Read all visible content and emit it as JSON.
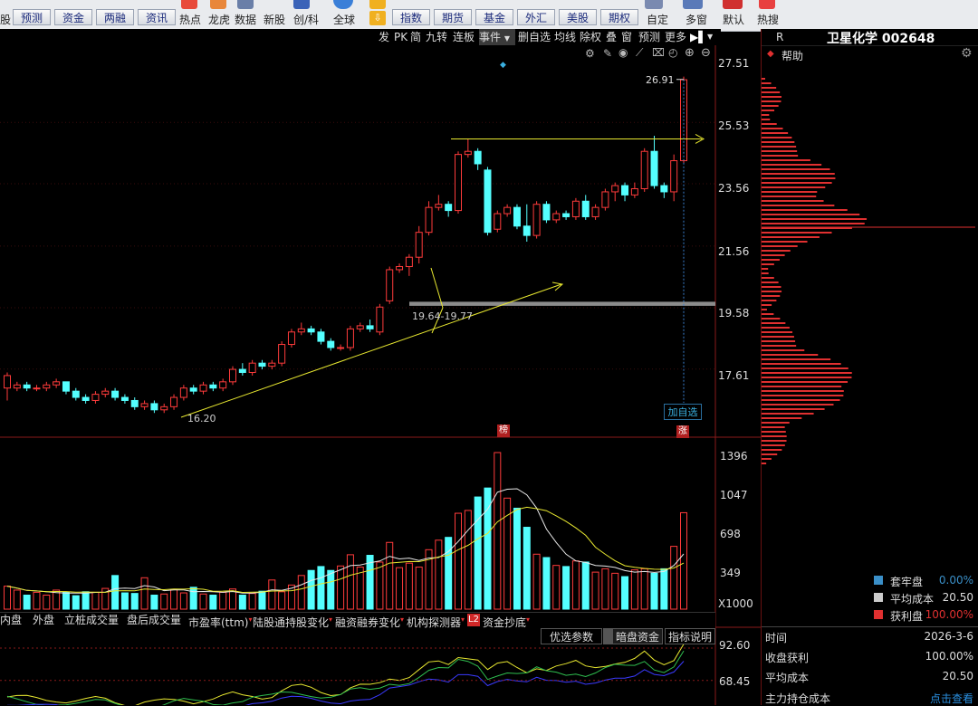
{
  "toolbar": {
    "buttons_row": [
      "预测",
      "资金",
      "两融",
      "资讯"
    ],
    "icon_labels": [
      "热点",
      "龙虎",
      "数据",
      "新股",
      "创/科"
    ],
    "global_label": "全球",
    "market_tabs": [
      "指数",
      "期货",
      "基金",
      "外汇",
      "美股",
      "期权"
    ],
    "right_labels": [
      "自定",
      "多窗",
      "默认",
      "热搜"
    ],
    "left_partial": "股"
  },
  "chartbar": {
    "items": [
      "发",
      "PK",
      "简",
      "九转",
      "连板",
      "事件",
      "删自选",
      "均线",
      "除权",
      "叠",
      "窗",
      "预测",
      "更多"
    ]
  },
  "stock": {
    "r_label": "R",
    "name_code": "卫星化学 002648",
    "help": "帮助"
  },
  "price_axis": [
    "27.51",
    "25.53",
    "23.56",
    "21.56",
    "19.58",
    "17.61"
  ],
  "annotations": {
    "high_label": "26.91",
    "support_label": "19.64-19.77",
    "low_label": "16.20",
    "add_watch": "加自选",
    "bang": "榜",
    "zhang": "涨"
  },
  "volume_axis": [
    "1396",
    "1047",
    "698",
    "349"
  ],
  "volume_unit": "X1000",
  "bottom_tabs": [
    "内盘",
    "外盘",
    "立桩成交量",
    "盘后成交量",
    "市盈率(ttm)",
    "陆股通持股变化",
    "融资融券变化",
    "机构探测器",
    "资金抄底"
  ],
  "l2_badge": "L2",
  "indicator_buttons": [
    "优选参数",
    "暗盘资金",
    "指标说明"
  ],
  "indicator_axis": [
    "92.60",
    "68.45"
  ],
  "legend": [
    {
      "label": "套牢盘",
      "value": "0.00%",
      "color": "#3a8fc8",
      "valcolor": "#3a8fc8"
    },
    {
      "label": "平均成本",
      "value": "20.50",
      "color": "#cccccc",
      "valcolor": "#dddddd"
    },
    {
      "label": "获利盘",
      "value": "100.00%",
      "color": "#e03030",
      "valcolor": "#e03030"
    }
  ],
  "info": [
    {
      "label": "时间",
      "value": "2026-3-6",
      "color": "#dddddd"
    },
    {
      "label": "收盘获利",
      "value": "100.00%",
      "color": "#dddddd"
    },
    {
      "label": "平均成本",
      "value": "20.50",
      "color": "#dddddd"
    },
    {
      "label": "主力持仓成本",
      "value": "点击查看",
      "color": "#2a8fe0"
    }
  ],
  "chart_data": {
    "type": "candlestick",
    "price_range": [
      15.8,
      27.6
    ],
    "candles": [
      [
        17.0,
        17.4,
        16.6,
        17.5
      ],
      [
        17.0,
        17.1,
        16.9,
        17.2
      ],
      [
        17.1,
        17.0,
        16.9,
        17.2
      ],
      [
        17.0,
        17.0,
        16.9,
        17.1
      ],
      [
        17.0,
        17.1,
        16.9,
        17.2
      ],
      [
        17.1,
        17.2,
        17.0,
        17.3
      ],
      [
        17.2,
        16.9,
        16.8,
        17.2
      ],
      [
        16.9,
        16.7,
        16.6,
        17.0
      ],
      [
        16.7,
        16.6,
        16.5,
        16.8
      ],
      [
        16.6,
        16.8,
        16.5,
        16.9
      ],
      [
        16.8,
        16.9,
        16.7,
        17.0
      ],
      [
        16.9,
        16.7,
        16.6,
        17.0
      ],
      [
        16.7,
        16.6,
        16.5,
        16.8
      ],
      [
        16.6,
        16.4,
        16.3,
        16.7
      ],
      [
        16.4,
        16.5,
        16.3,
        16.6
      ],
      [
        16.5,
        16.3,
        16.2,
        16.6
      ],
      [
        16.3,
        16.4,
        16.2,
        16.5
      ],
      [
        16.4,
        16.7,
        16.3,
        16.8
      ],
      [
        16.7,
        17.0,
        16.6,
        17.1
      ],
      [
        17.0,
        16.9,
        16.8,
        17.1
      ],
      [
        16.9,
        17.1,
        16.8,
        17.2
      ],
      [
        17.1,
        17.0,
        16.9,
        17.2
      ],
      [
        17.0,
        17.2,
        16.9,
        17.3
      ],
      [
        17.2,
        17.6,
        17.1,
        17.7
      ],
      [
        17.6,
        17.5,
        17.4,
        17.8
      ],
      [
        17.5,
        17.8,
        17.4,
        17.9
      ],
      [
        17.8,
        17.7,
        17.6,
        17.9
      ],
      [
        17.7,
        17.8,
        17.6,
        17.9
      ],
      [
        17.8,
        18.4,
        17.7,
        18.5
      ],
      [
        18.4,
        18.8,
        18.3,
        18.9
      ],
      [
        18.8,
        18.9,
        18.7,
        19.1
      ],
      [
        18.9,
        18.8,
        18.7,
        19.0
      ],
      [
        18.8,
        18.5,
        18.4,
        18.9
      ],
      [
        18.5,
        18.3,
        18.2,
        18.6
      ],
      [
        18.3,
        18.3,
        18.2,
        18.4
      ],
      [
        18.3,
        18.9,
        18.2,
        19.0
      ],
      [
        18.9,
        19.0,
        18.8,
        19.1
      ],
      [
        19.0,
        18.9,
        18.8,
        19.2
      ],
      [
        18.8,
        19.6,
        18.7,
        19.7
      ],
      [
        19.8,
        20.8,
        19.7,
        20.9
      ],
      [
        20.8,
        20.9,
        20.7,
        21.0
      ],
      [
        20.9,
        21.2,
        20.6,
        21.3
      ],
      [
        21.2,
        22.0,
        21.0,
        22.2
      ],
      [
        22.0,
        22.8,
        21.9,
        23.0
      ],
      [
        22.8,
        22.9,
        22.7,
        23.2
      ],
      [
        22.9,
        22.7,
        22.5,
        23.0
      ],
      [
        22.7,
        24.5,
        22.6,
        24.6
      ],
      [
        24.5,
        24.6,
        24.4,
        25.0
      ],
      [
        24.6,
        24.2,
        24.0,
        24.7
      ],
      [
        24.0,
        22.0,
        21.9,
        24.1
      ],
      [
        22.1,
        22.6,
        22.0,
        22.7
      ],
      [
        22.6,
        22.8,
        22.5,
        22.9
      ],
      [
        22.8,
        22.2,
        22.1,
        22.9
      ],
      [
        22.2,
        21.9,
        21.7,
        22.9
      ],
      [
        21.9,
        22.9,
        21.8,
        23.0
      ],
      [
        22.9,
        22.4,
        22.3,
        23.0
      ],
      [
        22.4,
        22.6,
        22.3,
        22.7
      ],
      [
        22.6,
        22.5,
        22.4,
        22.7
      ],
      [
        22.5,
        23.0,
        22.4,
        23.1
      ],
      [
        23.0,
        22.5,
        22.4,
        23.2
      ],
      [
        22.5,
        22.8,
        22.4,
        22.9
      ],
      [
        22.8,
        23.3,
        22.7,
        23.4
      ],
      [
        23.3,
        23.5,
        23.0,
        23.6
      ],
      [
        23.5,
        23.2,
        23.0,
        23.6
      ],
      [
        23.2,
        23.4,
        23.1,
        23.6
      ],
      [
        23.4,
        24.6,
        23.3,
        24.7
      ],
      [
        24.6,
        23.5,
        23.4,
        25.1
      ],
      [
        23.5,
        23.3,
        23.1,
        23.6
      ],
      [
        23.3,
        24.3,
        23.0,
        24.5
      ],
      [
        24.3,
        26.9,
        24.2,
        27.0
      ]
    ],
    "volumes": [
      205,
      170,
      125,
      150,
      125,
      170,
      150,
      120,
      155,
      150,
      185,
      300,
      145,
      140,
      280,
      125,
      135,
      175,
      145,
      195,
      135,
      125,
      150,
      180,
      125,
      140,
      160,
      260,
      155,
      215,
      300,
      345,
      380,
      345,
      385,
      485,
      375,
      480,
      420,
      595,
      370,
      410,
      375,
      530,
      615,
      640,
      855,
      880,
      1000,
      1080,
      1396,
      990,
      900,
      730,
      490,
      460,
      390,
      380,
      430,
      420,
      330,
      360,
      320,
      290,
      350,
      360,
      320,
      360,
      560,
      860,
      1060
    ],
    "support_band": [
      19.64,
      19.77
    ],
    "resistance": 25.0,
    "last_marker": 26.91
  }
}
